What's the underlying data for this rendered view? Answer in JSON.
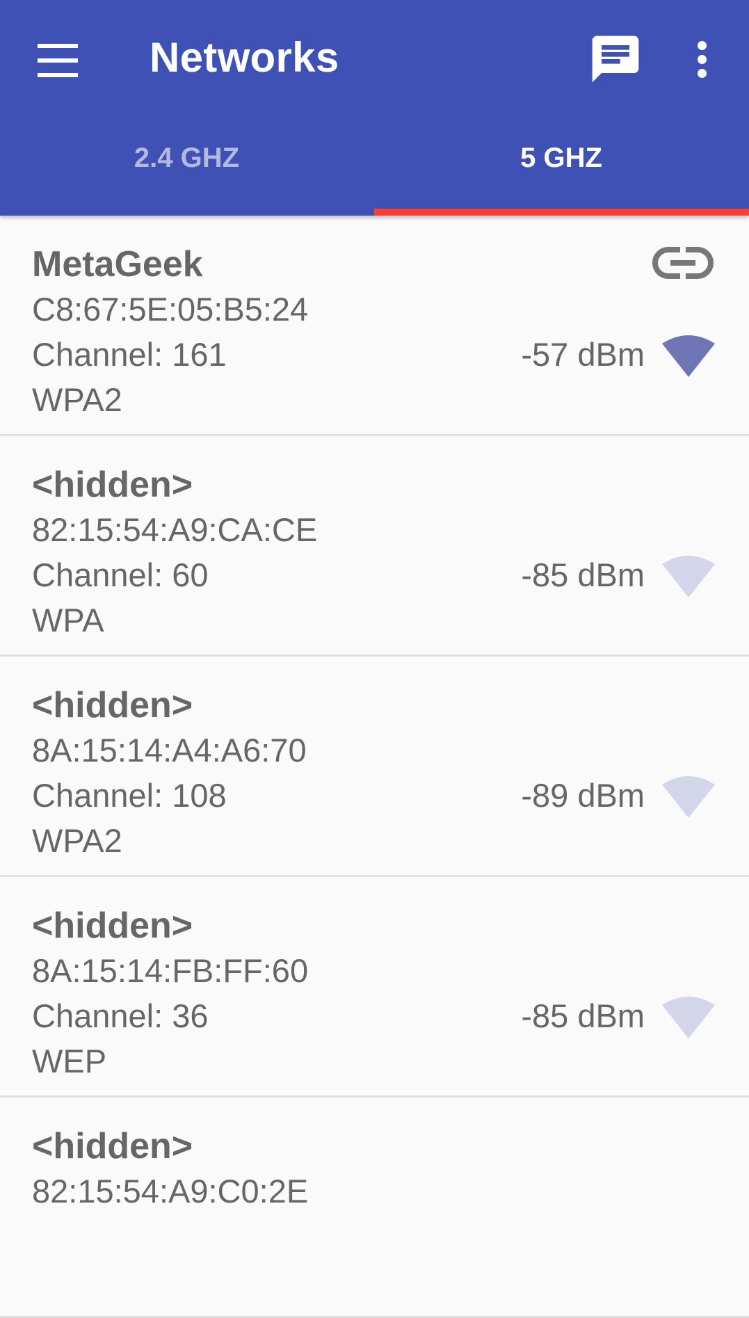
{
  "app_bar": {
    "title": "Networks",
    "color": "#3f51b5"
  },
  "tabs": [
    {
      "label": "2.4 GHZ",
      "selected": false
    },
    {
      "label": "5 GHZ",
      "selected": true
    }
  ],
  "tab_indicator_color": "#f44336",
  "icons": {
    "menu": "menu-icon",
    "feedback": "feedback-icon",
    "more": "more-vert-icon",
    "connected": "link-icon",
    "signal": "wifi-signal-icon"
  },
  "networks": [
    {
      "ssid": "MetaGeek",
      "bssid": "C8:67:5E:05:B5:24",
      "channel": "Channel: 161",
      "security": "WPA2",
      "signal": "-57 dBm",
      "connected": true,
      "signal_color": "#7075b5"
    },
    {
      "ssid": "<hidden>",
      "bssid": "82:15:54:A9:CA:CE",
      "channel": "Channel: 60",
      "security": "WPA",
      "signal": "-85 dBm",
      "connected": false,
      "signal_color": "#d3d5ea"
    },
    {
      "ssid": "<hidden>",
      "bssid": "8A:15:14:A4:A6:70",
      "channel": "Channel: 108",
      "security": "WPA2",
      "signal": "-89 dBm",
      "connected": false,
      "signal_color": "#d3d5ea"
    },
    {
      "ssid": "<hidden>",
      "bssid": "8A:15:14:FB:FF:60",
      "channel": "Channel: 36",
      "security": "WEP",
      "signal": "-85 dBm",
      "connected": false,
      "signal_color": "#d3d5ea"
    },
    {
      "ssid": "<hidden>",
      "bssid": "82:15:54:A9:C0:2E",
      "channel": "",
      "security": "",
      "signal": "",
      "connected": false,
      "signal_color": "#d3d5ea"
    }
  ]
}
